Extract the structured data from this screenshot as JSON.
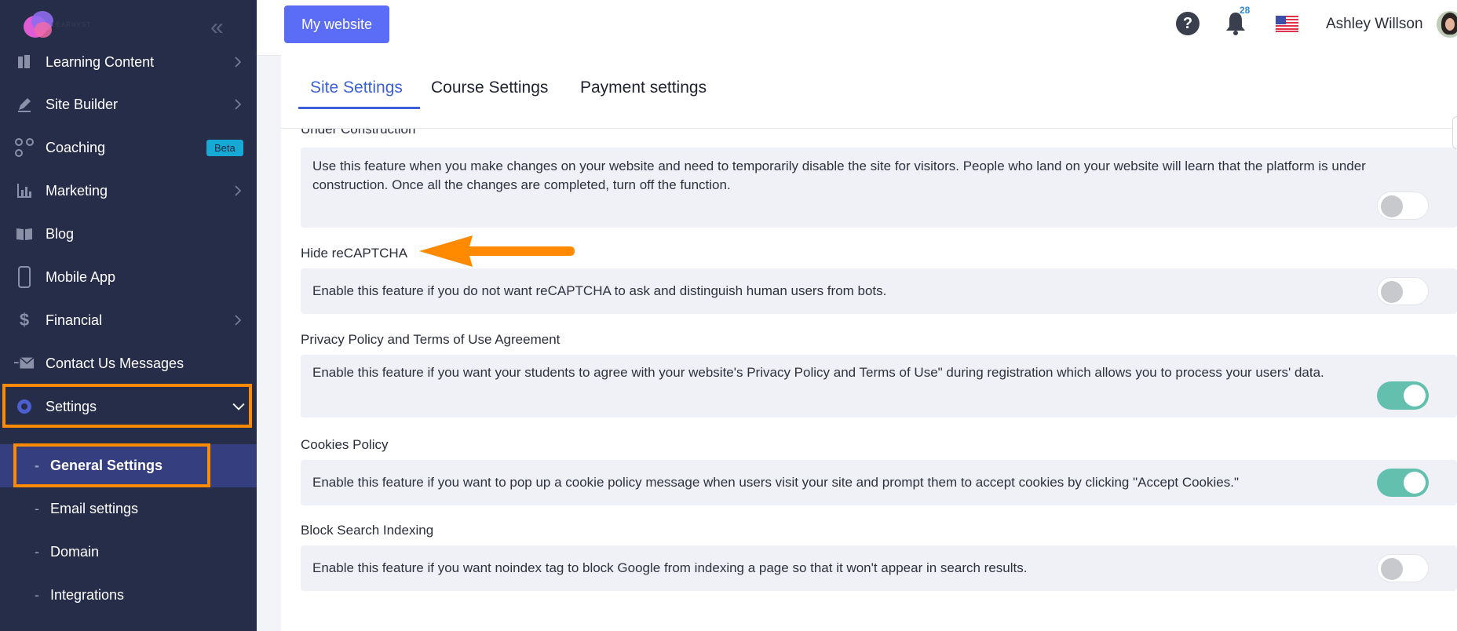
{
  "sidebar": {
    "logo_text": "LEARNYST",
    "items": [
      {
        "label": "Learning Content",
        "icon": "learning-content-icon",
        "has_chevron": true
      },
      {
        "label": "Site Builder",
        "icon": "pen-icon",
        "has_chevron": true
      },
      {
        "label": "Coaching",
        "icon": "coaching-icon",
        "badge": "Beta"
      },
      {
        "label": "Marketing",
        "icon": "bar-chart-icon",
        "has_chevron": true
      },
      {
        "label": "Blog",
        "icon": "book-icon"
      },
      {
        "label": "Mobile App",
        "icon": "phone-icon"
      },
      {
        "label": "Financial",
        "icon": "dollar-icon",
        "has_chevron": true
      },
      {
        "label": "Contact Us Messages",
        "icon": "envelope-icon"
      },
      {
        "label": "Settings",
        "icon": "gear-icon",
        "expanded": true
      }
    ],
    "sub_items": [
      {
        "label": "General Settings",
        "active": true
      },
      {
        "label": "Email settings"
      },
      {
        "label": "Domain"
      },
      {
        "label": "Integrations"
      }
    ]
  },
  "topbar": {
    "site_button": "My website",
    "notifications_count": "28",
    "user_name": "Ashley Willson"
  },
  "tabs": [
    {
      "label": "Site Settings",
      "active": true
    },
    {
      "label": "Course Settings"
    },
    {
      "label": "Payment settings"
    }
  ],
  "sections": [
    {
      "title": "Under Construction",
      "description": "Use this feature when you make changes on your website and need to temporarily disable the site for visitors. People who land on your website will learn that the platform is under construction. Once all the changes are completed, turn off the function.",
      "enabled": false
    },
    {
      "title": "Hide reCAPTCHA",
      "description": "Enable this feature if you do not want reCAPTCHA to ask and distinguish human users from bots.",
      "enabled": false
    },
    {
      "title": "Privacy Policy and Terms of Use Agreement",
      "description": "Enable this feature if you want your students to agree with your website's Privacy Policy and Terms of Use\" during registration which allows you to process your users' data.",
      "enabled": true
    },
    {
      "title": "Cookies Policy",
      "description": "Enable this feature if you want to pop up a cookie policy message when users visit your site and prompt them to accept cookies by clicking \"Accept Cookies.\"",
      "enabled": true
    },
    {
      "title": "Block Search Indexing",
      "description": "Enable this feature if you want noindex tag to block Google from indexing a page so that it won't appear in search results.",
      "enabled": false
    }
  ],
  "colors": {
    "sidebar_bg": "#262d48",
    "accent": "#5b6cf7",
    "highlight": "#ff8a00",
    "toggle_on": "#63bfae",
    "tab_active": "#3c60d8"
  }
}
